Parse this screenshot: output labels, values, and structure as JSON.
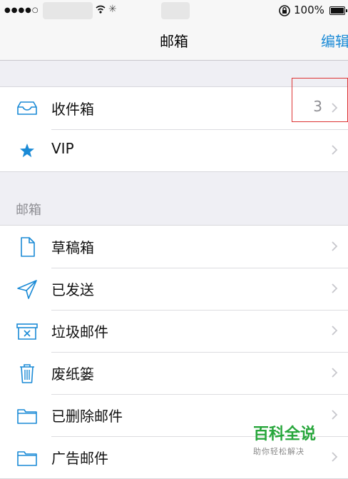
{
  "status_bar": {
    "battery_text": "100%"
  },
  "nav": {
    "title": "邮箱",
    "edit": "编辑"
  },
  "inbox_group": [
    {
      "label": "收件箱",
      "icon": "inbox-icon",
      "count": "3"
    },
    {
      "label": "VIP",
      "icon": "star-icon"
    }
  ],
  "section": {
    "header": "邮箱"
  },
  "mailboxes": [
    {
      "label": "草稿箱",
      "icon": "draft-icon"
    },
    {
      "label": "已发送",
      "icon": "paper-plane-icon"
    },
    {
      "label": "垃圾邮件",
      "icon": "junk-icon"
    },
    {
      "label": "废纸篓",
      "icon": "trash-icon"
    },
    {
      "label": "已删除邮件",
      "icon": "folder-icon"
    },
    {
      "label": "广告邮件",
      "icon": "folder-icon"
    }
  ],
  "watermark": {
    "title": "百科全说",
    "subtitle": "助你轻松解决"
  },
  "colors": {
    "accent": "#1a8ad6",
    "highlight": "#dd3333"
  }
}
